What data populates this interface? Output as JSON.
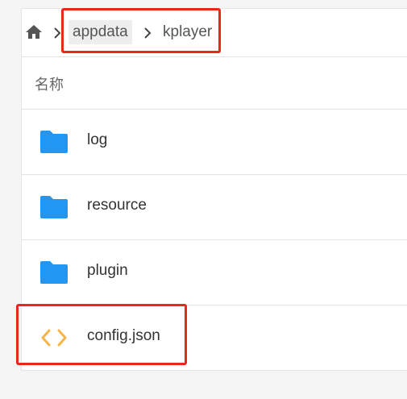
{
  "breadcrumb": {
    "home_icon": "home-icon",
    "separator_icon": "chevron-right-icon",
    "items": [
      {
        "label": "appdata"
      },
      {
        "label": "kplayer"
      }
    ]
  },
  "table": {
    "header": "名称",
    "rows": [
      {
        "name": "log",
        "type": "folder",
        "icon": "folder-icon"
      },
      {
        "name": "resource",
        "type": "folder",
        "icon": "folder-icon"
      },
      {
        "name": "plugin",
        "type": "folder",
        "icon": "folder-icon"
      },
      {
        "name": "config.json",
        "type": "file",
        "icon": "code-file-icon"
      }
    ]
  },
  "colors": {
    "folder": "#2196f3",
    "code_file": "#f6b54a",
    "annotation_box": "#e8271f",
    "background": "#f5f5f5"
  }
}
